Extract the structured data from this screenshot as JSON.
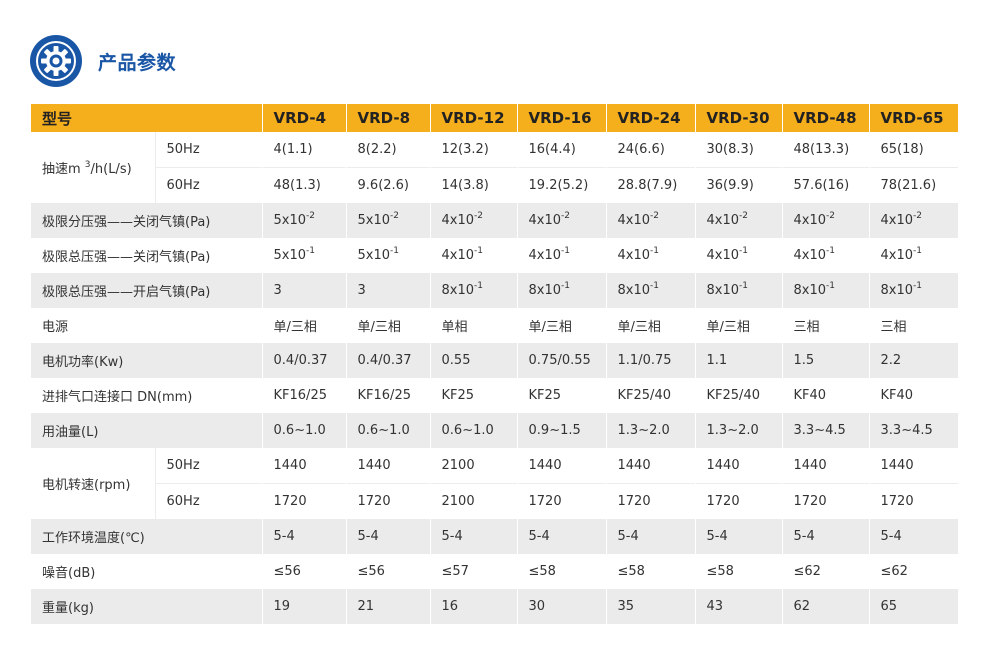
{
  "header": {
    "title": "产品参数",
    "icon": "gear-icon",
    "icon_color": "#1a56a6"
  },
  "colors": {
    "header_bg": "#f5ae1c",
    "stripe_bg": "#ebebeb",
    "accent": "#1a56a6"
  },
  "table": {
    "model_label": "型号",
    "models": [
      "VRD-4",
      "VRD-8",
      "VRD-12",
      "VRD-16",
      "VRD-24",
      "VRD-30",
      "VRD-48",
      "VRD-65"
    ],
    "pumping_speed": {
      "label_main": "抽速m ",
      "label_sup": "3",
      "label_tail": "/h(L/s)",
      "hz50_label": "50Hz",
      "hz50": [
        "4(1.1)",
        "8(2.2)",
        "12(3.2)",
        "16(4.4)",
        "24(6.6)",
        "30(8.3)",
        "48(13.3)",
        "65(18)"
      ],
      "hz60_label": "60Hz",
      "hz60": [
        "48(1.3)",
        "9.6(2.6)",
        "14(3.8)",
        "19.2(5.2)",
        "28.8(7.9)",
        "36(9.9)",
        "57.6(16)",
        "78(21.6)"
      ]
    },
    "partial_pressure": {
      "label": "极限分压强——关闭气镇(Pa)",
      "values": [
        {
          "base": "5x10",
          "exp": "-2"
        },
        {
          "base": "5x10",
          "exp": "-2"
        },
        {
          "base": "4x10",
          "exp": "-2"
        },
        {
          "base": "4x10",
          "exp": "-2"
        },
        {
          "base": "4x10",
          "exp": "-2"
        },
        {
          "base": "4x10",
          "exp": "-2"
        },
        {
          "base": "4x10",
          "exp": "-2"
        },
        {
          "base": "4x10",
          "exp": "-2"
        }
      ]
    },
    "total_pressure_closed": {
      "label": "极限总压强——关闭气镇(Pa)",
      "values": [
        {
          "base": "5x10",
          "exp": "-1"
        },
        {
          "base": "5x10",
          "exp": "-1"
        },
        {
          "base": "4x10",
          "exp": "-1"
        },
        {
          "base": "4x10",
          "exp": "-1"
        },
        {
          "base": "4x10",
          "exp": "-1"
        },
        {
          "base": "4x10",
          "exp": "-1"
        },
        {
          "base": "4x10",
          "exp": "-1"
        },
        {
          "base": "4x10",
          "exp": "-1"
        }
      ]
    },
    "total_pressure_open": {
      "label": "极限总压强——开启气镇(Pa)",
      "values": [
        {
          "base": "3",
          "exp": ""
        },
        {
          "base": "3",
          "exp": ""
        },
        {
          "base": "8x10",
          "exp": "-1"
        },
        {
          "base": "8x10",
          "exp": "-1"
        },
        {
          "base": "8x10",
          "exp": "-1"
        },
        {
          "base": "8x10",
          "exp": "-1"
        },
        {
          "base": "8x10",
          "exp": "-1"
        },
        {
          "base": "8x10",
          "exp": "-1"
        }
      ]
    },
    "power_supply": {
      "label": "电源",
      "values": [
        "单/三相",
        "单/三相",
        "单相",
        "单/三相",
        "单/三相",
        "单/三相",
        "三相",
        "三相"
      ]
    },
    "motor_power": {
      "label": "电机功率(Kw)",
      "values": [
        "0.4/0.37",
        "0.4/0.37",
        "0.55",
        "0.75/0.55",
        "1.1/0.75",
        "1.1",
        "1.5",
        "2.2"
      ]
    },
    "connection": {
      "label": "进排气口连接口 DN(mm)",
      "values": [
        "KF16/25",
        "KF16/25",
        "KF25",
        "KF25",
        "KF25/40",
        "KF25/40",
        "KF40",
        "KF40"
      ]
    },
    "oil": {
      "label": "用油量(L)",
      "values": [
        "0.6~1.0",
        "0.6~1.0",
        "0.6~1.0",
        "0.9~1.5",
        "1.3~2.0",
        "1.3~2.0",
        "3.3~4.5",
        "3.3~4.5"
      ]
    },
    "motor_speed": {
      "label": "电机转速(rpm)",
      "hz50_label": "50Hz",
      "hz50": [
        "1440",
        "1440",
        "2100",
        "1440",
        "1440",
        "1440",
        "1440",
        "1440"
      ],
      "hz60_label": "60Hz",
      "hz60": [
        "1720",
        "1720",
        "2100",
        "1720",
        "1720",
        "1720",
        "1720",
        "1720"
      ]
    },
    "ambient_temp": {
      "label": "工作环境温度(℃)",
      "values": [
        "5-4",
        "5-4",
        "5-4",
        "5-4",
        "5-4",
        "5-4",
        "5-4",
        "5-4"
      ]
    },
    "noise": {
      "label": "噪音(dB)",
      "values": [
        "≤56",
        "≤56",
        "≤57",
        "≤58",
        "≤58",
        "≤58",
        "≤62",
        "≤62"
      ]
    },
    "weight": {
      "label": "重量(kg)",
      "values": [
        "19",
        "21",
        "16",
        "30",
        "35",
        "43",
        "62",
        "65"
      ]
    }
  }
}
